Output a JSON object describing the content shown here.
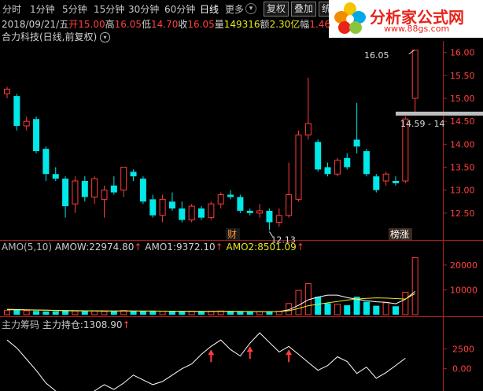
{
  "toolbar": {
    "periods": [
      {
        "label": "分时",
        "active": false
      },
      {
        "label": "1分钟",
        "active": false
      },
      {
        "label": "5分钟",
        "active": false
      },
      {
        "label": "15分钟",
        "active": false
      },
      {
        "label": "30分钟",
        "active": false
      },
      {
        "label": "60分钟",
        "active": false
      },
      {
        "label": "日线",
        "active": true
      }
    ],
    "more_label": "更多",
    "restore_label": "复权",
    "overlay_label": "叠加",
    "partial_label": "统"
  },
  "logo": {
    "text": "分析家公式网",
    "url": "www.88gs.com"
  },
  "quote": {
    "date": "2018/09/21/五",
    "open_label": "开",
    "open": "15.00",
    "high_label": "高",
    "high": "16.05",
    "low_label": "低",
    "low": "14.70",
    "close_label": "收",
    "close": "16.05",
    "volume_label": "量",
    "volume": "149316",
    "amount_label": "额",
    "amount": "2.30亿",
    "change_label": "幅",
    "change": "1.46"
  },
  "stock": {
    "title": "合力科技(日线,前复权)"
  },
  "price_panel": {
    "y_ticks": [
      "16.00",
      "15.50",
      "15.00",
      "14.50",
      "14.00",
      "13.50",
      "13.00",
      "12.50"
    ],
    "high_marker": "16.05",
    "low_marker": "12.13",
    "cursor_label": "14.59 - 14",
    "event_badges": [
      {
        "text": "财"
      },
      {
        "text": "榜涨"
      }
    ]
  },
  "amo_panel": {
    "name": "AMO(5,10)",
    "items": [
      {
        "label": "AMOW:",
        "value": "22974.80",
        "color": "#d0d0d0"
      },
      {
        "label": "AMO1:",
        "value": "9372.10",
        "color": "#d0d0d0"
      },
      {
        "label": "AMO2:",
        "value": "8501.09",
        "color": "#e8e820"
      }
    ],
    "y_ticks": [
      "20000",
      "10000"
    ]
  },
  "chip_panel": {
    "name": "主力筹码",
    "item_label": "主力持仓:",
    "item_value": "1308.90",
    "y_ticks": [
      "2500",
      "0.00"
    ]
  },
  "chart_data": [
    {
      "type": "candlestick",
      "title": "合力科技(日线,前复权)",
      "ylim": [
        12.0,
        16.2
      ],
      "candles": [
        {
          "o": 15.1,
          "h": 15.25,
          "l": 15.0,
          "c": 15.2
        },
        {
          "o": 15.05,
          "h": 15.1,
          "l": 14.3,
          "c": 14.4
        },
        {
          "o": 14.4,
          "h": 14.6,
          "l": 14.3,
          "c": 14.5
        },
        {
          "o": 14.55,
          "h": 14.6,
          "l": 13.8,
          "c": 13.85
        },
        {
          "o": 13.9,
          "h": 13.95,
          "l": 13.2,
          "c": 13.35
        },
        {
          "o": 13.35,
          "h": 13.5,
          "l": 13.2,
          "c": 13.25
        },
        {
          "o": 13.25,
          "h": 13.3,
          "l": 12.4,
          "c": 12.65
        },
        {
          "o": 12.7,
          "h": 13.3,
          "l": 12.5,
          "c": 13.2
        },
        {
          "o": 13.2,
          "h": 13.3,
          "l": 12.75,
          "c": 12.85
        },
        {
          "o": 12.85,
          "h": 13.3,
          "l": 12.7,
          "c": 13.25
        },
        {
          "o": 12.8,
          "h": 13.1,
          "l": 12.4,
          "c": 13.0
        },
        {
          "o": 13.1,
          "h": 13.3,
          "l": 12.9,
          "c": 12.95
        },
        {
          "o": 13.0,
          "h": 13.5,
          "l": 12.85,
          "c": 13.5
        },
        {
          "o": 13.4,
          "h": 13.45,
          "l": 13.2,
          "c": 13.3
        },
        {
          "o": 13.25,
          "h": 13.3,
          "l": 12.7,
          "c": 12.75
        },
        {
          "o": 12.8,
          "h": 12.9,
          "l": 12.4,
          "c": 12.45
        },
        {
          "o": 12.45,
          "h": 12.9,
          "l": 12.3,
          "c": 12.8
        },
        {
          "o": 12.75,
          "h": 12.95,
          "l": 12.55,
          "c": 12.6
        },
        {
          "o": 12.6,
          "h": 12.75,
          "l": 12.3,
          "c": 12.35
        },
        {
          "o": 12.35,
          "h": 12.7,
          "l": 12.3,
          "c": 12.65
        },
        {
          "o": 12.6,
          "h": 12.65,
          "l": 12.35,
          "c": 12.4
        },
        {
          "o": 12.4,
          "h": 12.75,
          "l": 12.35,
          "c": 12.7
        },
        {
          "o": 12.7,
          "h": 12.95,
          "l": 12.6,
          "c": 12.9
        },
        {
          "o": 12.9,
          "h": 13.0,
          "l": 12.8,
          "c": 12.85
        },
        {
          "o": 12.85,
          "h": 12.9,
          "l": 12.5,
          "c": 12.55
        },
        {
          "o": 12.55,
          "h": 12.6,
          "l": 12.45,
          "c": 12.5
        },
        {
          "o": 12.5,
          "h": 12.7,
          "l": 12.4,
          "c": 12.55
        },
        {
          "o": 12.55,
          "h": 12.6,
          "l": 12.13,
          "c": 12.3
        },
        {
          "o": 12.3,
          "h": 12.6,
          "l": 12.2,
          "c": 12.45
        },
        {
          "o": 12.45,
          "h": 13.6,
          "l": 12.4,
          "c": 12.9
        },
        {
          "o": 12.8,
          "h": 14.3,
          "l": 12.75,
          "c": 14.2
        },
        {
          "o": 14.2,
          "h": 15.45,
          "l": 14.1,
          "c": 14.45
        },
        {
          "o": 14.05,
          "h": 14.1,
          "l": 13.4,
          "c": 13.45
        },
        {
          "o": 13.5,
          "h": 13.6,
          "l": 13.3,
          "c": 13.35
        },
        {
          "o": 13.35,
          "h": 13.7,
          "l": 13.3,
          "c": 13.65
        },
        {
          "o": 13.7,
          "h": 13.8,
          "l": 13.45,
          "c": 13.5
        },
        {
          "o": 14.1,
          "h": 14.9,
          "l": 13.8,
          "c": 13.95
        },
        {
          "o": 13.85,
          "h": 13.9,
          "l": 13.3,
          "c": 13.35
        },
        {
          "o": 13.3,
          "h": 13.35,
          "l": 12.95,
          "c": 13.0
        },
        {
          "o": 13.2,
          "h": 13.4,
          "l": 13.1,
          "c": 13.35
        },
        {
          "o": 13.2,
          "h": 13.3,
          "l": 13.1,
          "c": 13.15
        },
        {
          "o": 13.2,
          "h": 14.6,
          "l": 13.15,
          "c": 14.55
        },
        {
          "o": 15.0,
          "h": 16.05,
          "l": 14.7,
          "c": 16.05
        }
      ]
    },
    {
      "type": "bar",
      "title": "AMO(5,10)",
      "ylim": [
        0,
        26000
      ],
      "values": [
        1800,
        2200,
        1600,
        1500,
        1300,
        1400,
        1600,
        1500,
        1400,
        1500,
        1300,
        1400,
        1700,
        1500,
        1400,
        1500,
        1400,
        1300,
        1200,
        1300,
        1200,
        1400,
        1500,
        1300,
        1200,
        1100,
        1200,
        1300,
        1400,
        4500,
        9800,
        12500,
        7200,
        4600,
        4200,
        3800,
        7200,
        5200,
        3600,
        4800,
        3400,
        9000,
        22974.8
      ],
      "series": [
        {
          "name": "AMO1",
          "values": [
            2200,
            2100,
            2000,
            1900,
            1800,
            1700,
            1600,
            1550,
            1500,
            1500,
            1450,
            1450,
            1480,
            1470,
            1460,
            1450,
            1420,
            1380,
            1340,
            1320,
            1300,
            1310,
            1330,
            1320,
            1300,
            1260,
            1240,
            1250,
            1280,
            1980,
            3780,
            6000,
            7100,
            7900,
            7900,
            6900,
            6200,
            5600,
            5200,
            5000,
            4400,
            6200,
            9372.1
          ]
        },
        {
          "name": "AMO2",
          "values": [
            2000,
            1950,
            1900,
            1850,
            1800,
            1750,
            1700,
            1650,
            1600,
            1580,
            1550,
            1520,
            1500,
            1480,
            1470,
            1460,
            1440,
            1420,
            1400,
            1380,
            1360,
            1350,
            1340,
            1330,
            1310,
            1290,
            1280,
            1270,
            1270,
            1600,
            2500,
            3600,
            4200,
            4800,
            5300,
            5900,
            6300,
            6600,
            6800,
            6700,
            6500,
            6300,
            8501.09
          ]
        }
      ]
    },
    {
      "type": "line",
      "title": "主力筹码",
      "ylim": [
        -2500,
        5000
      ],
      "series": [
        {
          "name": "主力持仓",
          "values": [
            3600,
            2600,
            1200,
            -200,
            -1800,
            -2800,
            -3500,
            -4000,
            -3400,
            -2800,
            -2000,
            -2600,
            -1800,
            -800,
            -1400,
            -2000,
            -1600,
            -800,
            0,
            600,
            1800,
            2800,
            3600,
            2400,
            1600,
            3200,
            4500,
            3300,
            2100,
            2800,
            1800,
            800,
            -200,
            400,
            1500,
            900,
            -600,
            200,
            -1200,
            -500,
            400,
            1308.9
          ]
        }
      ],
      "signals": [
        21,
        25,
        29
      ]
    }
  ]
}
